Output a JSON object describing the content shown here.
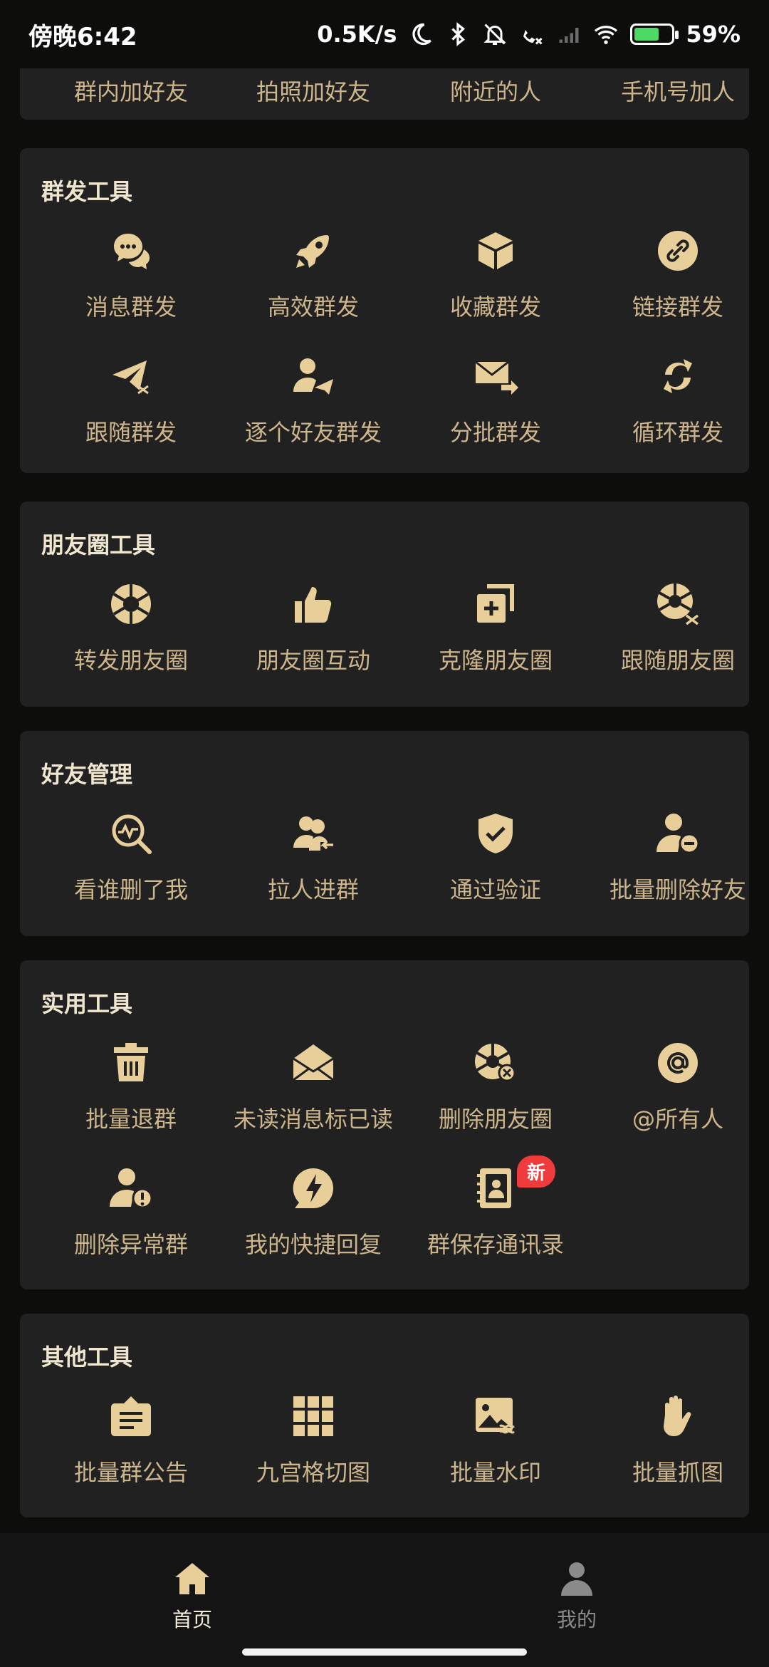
{
  "status_bar": {
    "time": "傍晚6:42",
    "net_speed": "0.5K/s",
    "battery": "59%"
  },
  "top_partial_row": [
    "群内加好友",
    "拍照加好友",
    "附近的人",
    "手机号加人"
  ],
  "sections": [
    {
      "title": "群发工具",
      "items": [
        {
          "label": "消息群发",
          "icon": "chat-bubbles-icon"
        },
        {
          "label": "高效群发",
          "icon": "rocket-icon"
        },
        {
          "label": "收藏群发",
          "icon": "box-icon"
        },
        {
          "label": "链接群发",
          "icon": "link-icon"
        },
        {
          "label": "跟随群发",
          "icon": "paper-plane-shuffle-icon"
        },
        {
          "label": "逐个好友群发",
          "icon": "user-send-icon"
        },
        {
          "label": "分批群发",
          "icon": "mail-forward-icon"
        },
        {
          "label": "循环群发",
          "icon": "cycle-icon"
        }
      ]
    },
    {
      "title": "朋友圈工具",
      "items": [
        {
          "label": "转发朋友圈",
          "icon": "aperture-icon"
        },
        {
          "label": "朋友圈互动",
          "icon": "thumbs-up-icon"
        },
        {
          "label": "克隆朋友圈",
          "icon": "clone-icon"
        },
        {
          "label": "跟随朋友圈",
          "icon": "aperture-shuffle-icon"
        }
      ]
    },
    {
      "title": "好友管理",
      "items": [
        {
          "label": "看谁删了我",
          "icon": "search-pulse-icon"
        },
        {
          "label": "拉人进群",
          "icon": "users-add-icon"
        },
        {
          "label": "通过验证",
          "icon": "shield-check-icon"
        },
        {
          "label": "批量删除好友",
          "icon": "user-remove-icon"
        }
      ]
    },
    {
      "title": "实用工具",
      "items": [
        {
          "label": "批量退群",
          "icon": "trash-icon"
        },
        {
          "label": "未读消息标已读",
          "icon": "envelope-open-icon"
        },
        {
          "label": "删除朋友圈",
          "icon": "aperture-delete-icon"
        },
        {
          "label": "@所有人",
          "icon": "at-icon"
        },
        {
          "label": "删除异常群",
          "icon": "user-warning-icon"
        },
        {
          "label": "我的快捷回复",
          "icon": "bolt-bubble-icon"
        },
        {
          "label": "群保存通讯录",
          "icon": "contact-book-icon",
          "badge": "新"
        }
      ]
    },
    {
      "title": "其他工具",
      "items": [
        {
          "label": "批量群公告",
          "icon": "notice-board-icon"
        },
        {
          "label": "九宫格切图",
          "icon": "grid-icon"
        },
        {
          "label": "批量水印",
          "icon": "image-watermark-icon"
        },
        {
          "label": "批量抓图",
          "icon": "hand-grab-icon"
        }
      ]
    }
  ],
  "bottom_nav": [
    {
      "label": "首页",
      "icon": "home-icon",
      "active": true
    },
    {
      "label": "我的",
      "icon": "person-icon",
      "active": false
    }
  ],
  "colors": {
    "accent": "#e8cf9a",
    "card": "#212121",
    "bg": "#0d0d0b",
    "badge": "#ef3b3b",
    "nav_inactive": "#8a8a8a"
  }
}
